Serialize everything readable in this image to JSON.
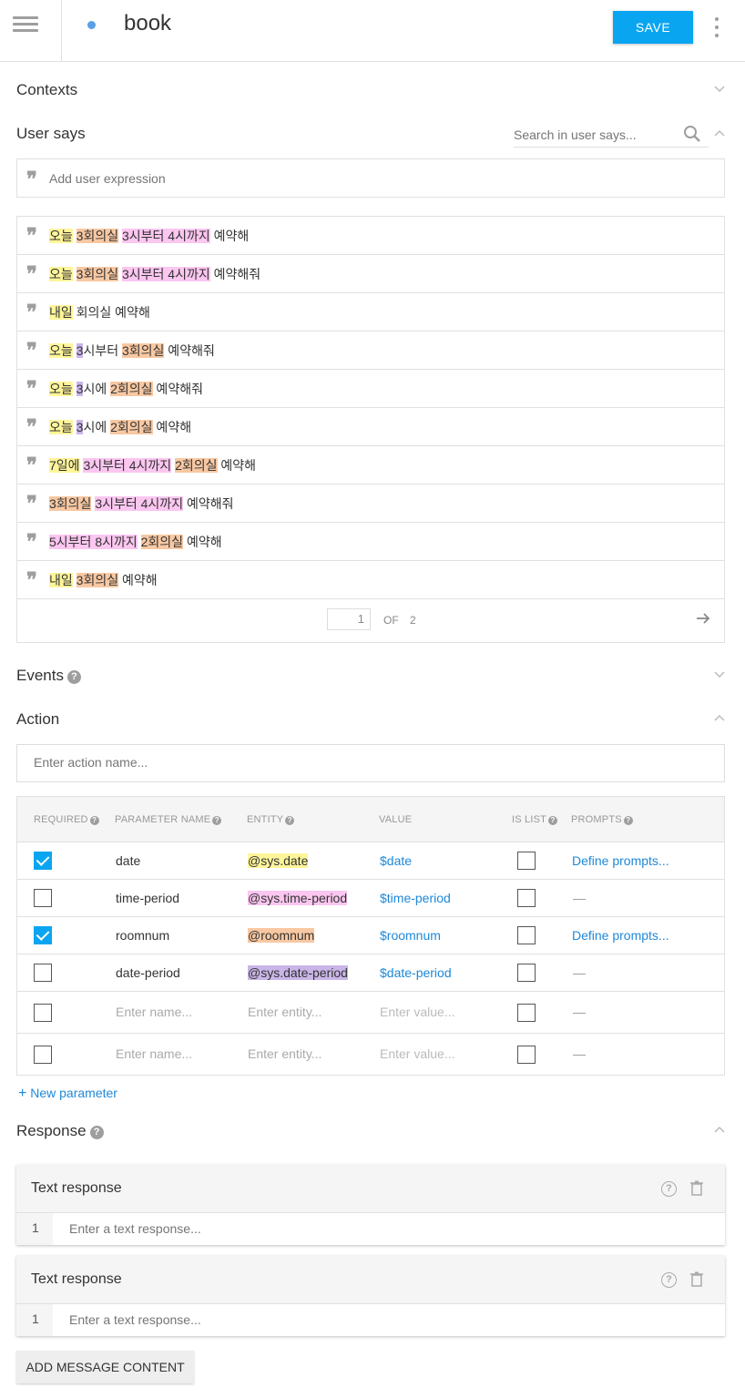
{
  "header": {
    "intent_name": "book",
    "save_label": "SAVE"
  },
  "sections": {
    "contexts": "Contexts",
    "user_says": "User says",
    "events": "Events",
    "action": "Action",
    "response": "Response"
  },
  "user_says": {
    "search_placeholder": "Search in user says...",
    "add_placeholder": "Add user expression",
    "expressions": [
      [
        [
          "오늘",
          "yellow"
        ],
        [
          " ",
          ""
        ],
        [
          "3회의실",
          "orange"
        ],
        [
          " ",
          ""
        ],
        [
          "3시부터 4시까지",
          "pink"
        ],
        [
          " 예약해",
          ""
        ]
      ],
      [
        [
          "오늘",
          "yellow"
        ],
        [
          " ",
          ""
        ],
        [
          "3회의실",
          "orange"
        ],
        [
          " ",
          ""
        ],
        [
          "3시부터 4시까지",
          "pink"
        ],
        [
          " 예약해줘",
          ""
        ]
      ],
      [
        [
          "내일",
          "yellow"
        ],
        [
          " 회의실 예약해",
          ""
        ]
      ],
      [
        [
          "오늘",
          "yellow"
        ],
        [
          " ",
          ""
        ],
        [
          "3",
          "purple"
        ],
        [
          "시부터 ",
          ""
        ],
        [
          "3회의실",
          "orange"
        ],
        [
          " 예약해줘",
          ""
        ]
      ],
      [
        [
          "오늘",
          "yellow"
        ],
        [
          " ",
          ""
        ],
        [
          "3",
          "purple"
        ],
        [
          "시에 ",
          ""
        ],
        [
          "2회의실",
          "orange"
        ],
        [
          " 예약해줘",
          ""
        ]
      ],
      [
        [
          "오늘",
          "yellow"
        ],
        [
          " ",
          ""
        ],
        [
          "3",
          "purple"
        ],
        [
          "시에 ",
          ""
        ],
        [
          "2회의실",
          "orange"
        ],
        [
          " 예약해",
          ""
        ]
      ],
      [
        [
          "7일에",
          "yellow"
        ],
        [
          " ",
          ""
        ],
        [
          "3시부터 4시까지",
          "pink"
        ],
        [
          " ",
          ""
        ],
        [
          "2회의실",
          "orange"
        ],
        [
          " 예약해",
          ""
        ]
      ],
      [
        [
          "3회의실",
          "orange"
        ],
        [
          " ",
          ""
        ],
        [
          "3시부터 4시까지",
          "pink"
        ],
        [
          " 예약해줘",
          ""
        ]
      ],
      [
        [
          "5시부터 8시까지",
          "pink"
        ],
        [
          " ",
          ""
        ],
        [
          "2회의실",
          "orange"
        ],
        [
          " 예약해",
          ""
        ]
      ],
      [
        [
          "내일",
          "yellow"
        ],
        [
          " ",
          ""
        ],
        [
          "3회의실",
          "orange"
        ],
        [
          " 예약해",
          ""
        ]
      ]
    ],
    "pager": {
      "current": "1",
      "of": "OF",
      "total": "2"
    }
  },
  "action": {
    "placeholder": "Enter action name..."
  },
  "params": {
    "headers": {
      "required": "REQUIRED",
      "name": "PARAMETER NAME",
      "entity": "ENTITY",
      "value": "VALUE",
      "is_list": "IS LIST",
      "prompts": "PROMPTS"
    },
    "rows": [
      {
        "required": true,
        "name": "date",
        "entity": "@sys.date",
        "value": "$date",
        "prompt": "Define prompts..."
      },
      {
        "required": false,
        "name": "time-period",
        "entity": "@sys.time-period",
        "value": "$time-period",
        "prompt": "—"
      },
      {
        "required": true,
        "name": "roomnum",
        "entity": "@roomnum",
        "value": "$roomnum",
        "prompt": "Define prompts..."
      },
      {
        "required": false,
        "name": "date-period",
        "entity": "@sys.date-period",
        "value": "$date-period",
        "prompt": "—"
      }
    ],
    "empty_row": {
      "name_placeholder": "Enter name...",
      "entity_placeholder": "Enter entity...",
      "value_placeholder": "Enter value...",
      "prompt": "—"
    },
    "new_parameter": "New parameter"
  },
  "response": {
    "cards": [
      {
        "title": "Text response",
        "line": "1",
        "placeholder": "Enter a text response..."
      },
      {
        "title": "Text response",
        "line": "1",
        "placeholder": "Enter a text response..."
      }
    ],
    "add_message": "ADD MESSAGE CONTENT"
  },
  "colors": {
    "accent": "#0aa5f1",
    "link": "#1e88d8",
    "yellow": "#fff59a",
    "orange": "#f8c8a2",
    "pink": "#fbc6f0",
    "purple": "#c9b5e8"
  }
}
